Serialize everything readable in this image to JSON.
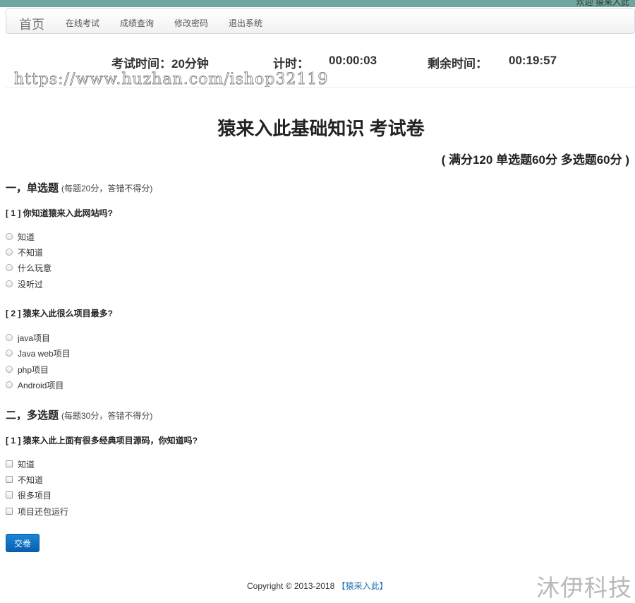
{
  "topbar": {
    "user_text": "欢迎 猿来入此"
  },
  "nav": {
    "brand": "首页",
    "items": [
      "在线考试",
      "成绩查询",
      "修改密码",
      "退出系统"
    ]
  },
  "timer": {
    "exam_time_label": "考试时间：20分钟",
    "elapsed_label": "计时：",
    "elapsed_value": "00:00:03",
    "remaining_label": "剩余时间：",
    "remaining_value": "00:19:57"
  },
  "watermark_url": "https://www.huzhan.com/ishop32119",
  "exam": {
    "title": "猿来入此基础知识  考试卷",
    "score_info": "( 满分120  单选题60分  多选题60分 )"
  },
  "single": {
    "heading": "一，单选题",
    "note": "(每题20分，答错不得分)",
    "questions": [
      {
        "text": "[ 1 ] 你知道猿来入此网站吗?",
        "options": [
          "知道",
          "不知道",
          "什么玩意",
          "没听过"
        ]
      },
      {
        "text": "[ 2 ] 猿来入此很么项目最多?",
        "options": [
          "java项目",
          "Java web项目",
          "php项目",
          "Android项目"
        ]
      }
    ]
  },
  "multi": {
    "heading": "二，多选题",
    "note": "(每题30分，答错不得分)",
    "questions": [
      {
        "text": "[ 1 ] 猿来入此上面有很多经典项目源码，你知道吗?",
        "options": [
          "知道",
          "不知道",
          "很多项目",
          "项目还包运行"
        ]
      }
    ]
  },
  "submit_label": "交卷",
  "footer": {
    "copyright": "Copyright © 2013-2018",
    "link": "【猿来入此】"
  },
  "watermark_brand": "沐伊科技"
}
